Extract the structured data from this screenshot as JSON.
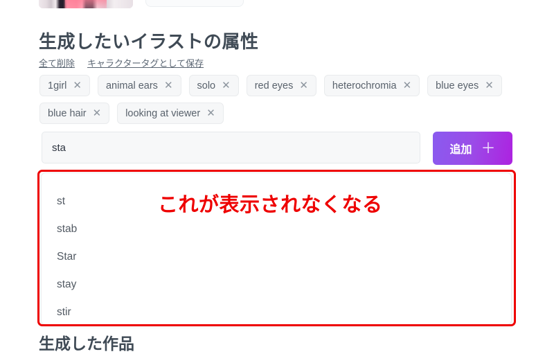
{
  "section": {
    "title": "生成したいイラストの属性",
    "links": [
      {
        "label": "全て削除",
        "name": "clear-all-link"
      },
      {
        "label": "キャラクタータグとして保存",
        "name": "save-as-character-tag-link"
      }
    ]
  },
  "tags": [
    {
      "label": "1girl",
      "remove": "✕"
    },
    {
      "label": "animal ears",
      "remove": "✕"
    },
    {
      "label": "solo",
      "remove": "✕"
    },
    {
      "label": "red eyes",
      "remove": "✕"
    },
    {
      "label": "heterochromia",
      "remove": "✕"
    },
    {
      "label": "blue eyes",
      "remove": "✕"
    },
    {
      "label": "blue hair",
      "remove": "✕"
    },
    {
      "label": "looking at viewer",
      "remove": "✕"
    }
  ],
  "entry": {
    "input_value": "sta",
    "input_placeholder": "",
    "add_button_label": "追加",
    "add_button_icon": "plus-icon",
    "add_button_plus": "＋"
  },
  "suggestions": {
    "items": [
      "st",
      "stab",
      "Star",
      "stay",
      "stir"
    ]
  },
  "annotation": {
    "note": "これが表示されなくなる",
    "color": "#ee0000"
  },
  "bottom": {
    "title": "生成した作品"
  },
  "colors": {
    "accent_gradient_start": "#8a5bef",
    "accent_gradient_end": "#ad22e0",
    "tag_bg": "#f6f7f8",
    "input_bg": "#f7f8f9",
    "heading_text": "#3f4a55",
    "annotation_red": "#ee0000"
  }
}
